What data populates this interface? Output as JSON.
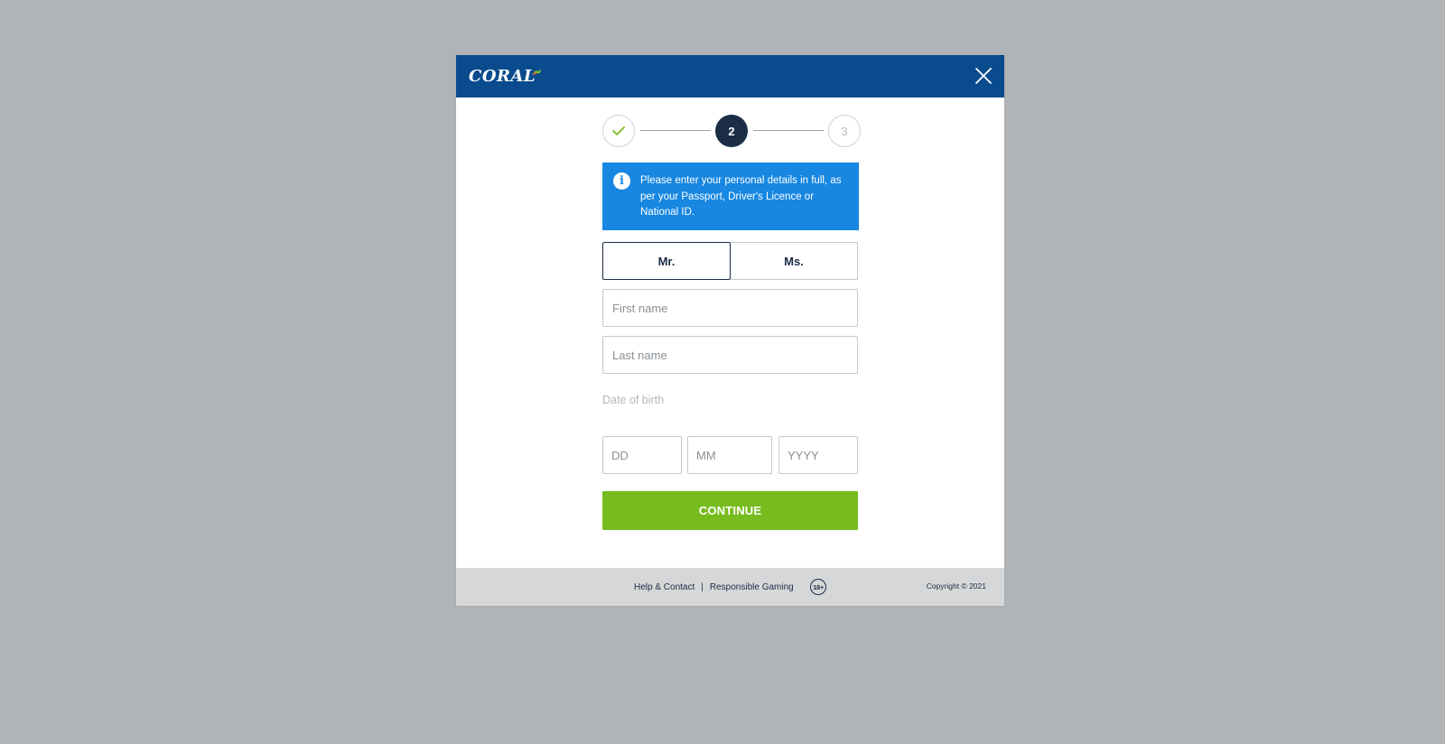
{
  "colors": {
    "backdrop": "#b1b4b6",
    "header": "#094b8d",
    "info_box": "#1787e1",
    "active_step": "#1b2d45",
    "check": "#77bc1f",
    "continue": "#77bc1f",
    "footer": "#d6d7d8"
  },
  "header": {
    "logo_text": "CORAL",
    "close_icon": "close-icon"
  },
  "stepper": {
    "steps": [
      {
        "label": "",
        "state": "completed",
        "icon": "check-icon"
      },
      {
        "label": "2",
        "state": "active"
      },
      {
        "label": "3",
        "state": "upcoming"
      }
    ]
  },
  "info": {
    "icon": "info-icon",
    "icon_glyph": "i",
    "message": "Please enter your personal details in full, as per your Passport, Driver's Licence or National ID."
  },
  "form": {
    "title_options": [
      {
        "label": "Mr.",
        "selected": true
      },
      {
        "label": "Ms.",
        "selected": false
      }
    ],
    "first_name": {
      "value": "",
      "placeholder": "First name"
    },
    "last_name": {
      "value": "",
      "placeholder": "Last name"
    },
    "dob_label": "Date of birth",
    "dob": {
      "day": {
        "value": "",
        "placeholder": "DD"
      },
      "month": {
        "value": "",
        "placeholder": "MM"
      },
      "year": {
        "value": "",
        "placeholder": "YYYY"
      }
    },
    "continue_label": "CONTINUE"
  },
  "footer": {
    "links": [
      "Help & Contact",
      "Responsible Gaming"
    ],
    "separator": "|",
    "age_badge": "18+",
    "copyright": "Copyright © 2021"
  }
}
